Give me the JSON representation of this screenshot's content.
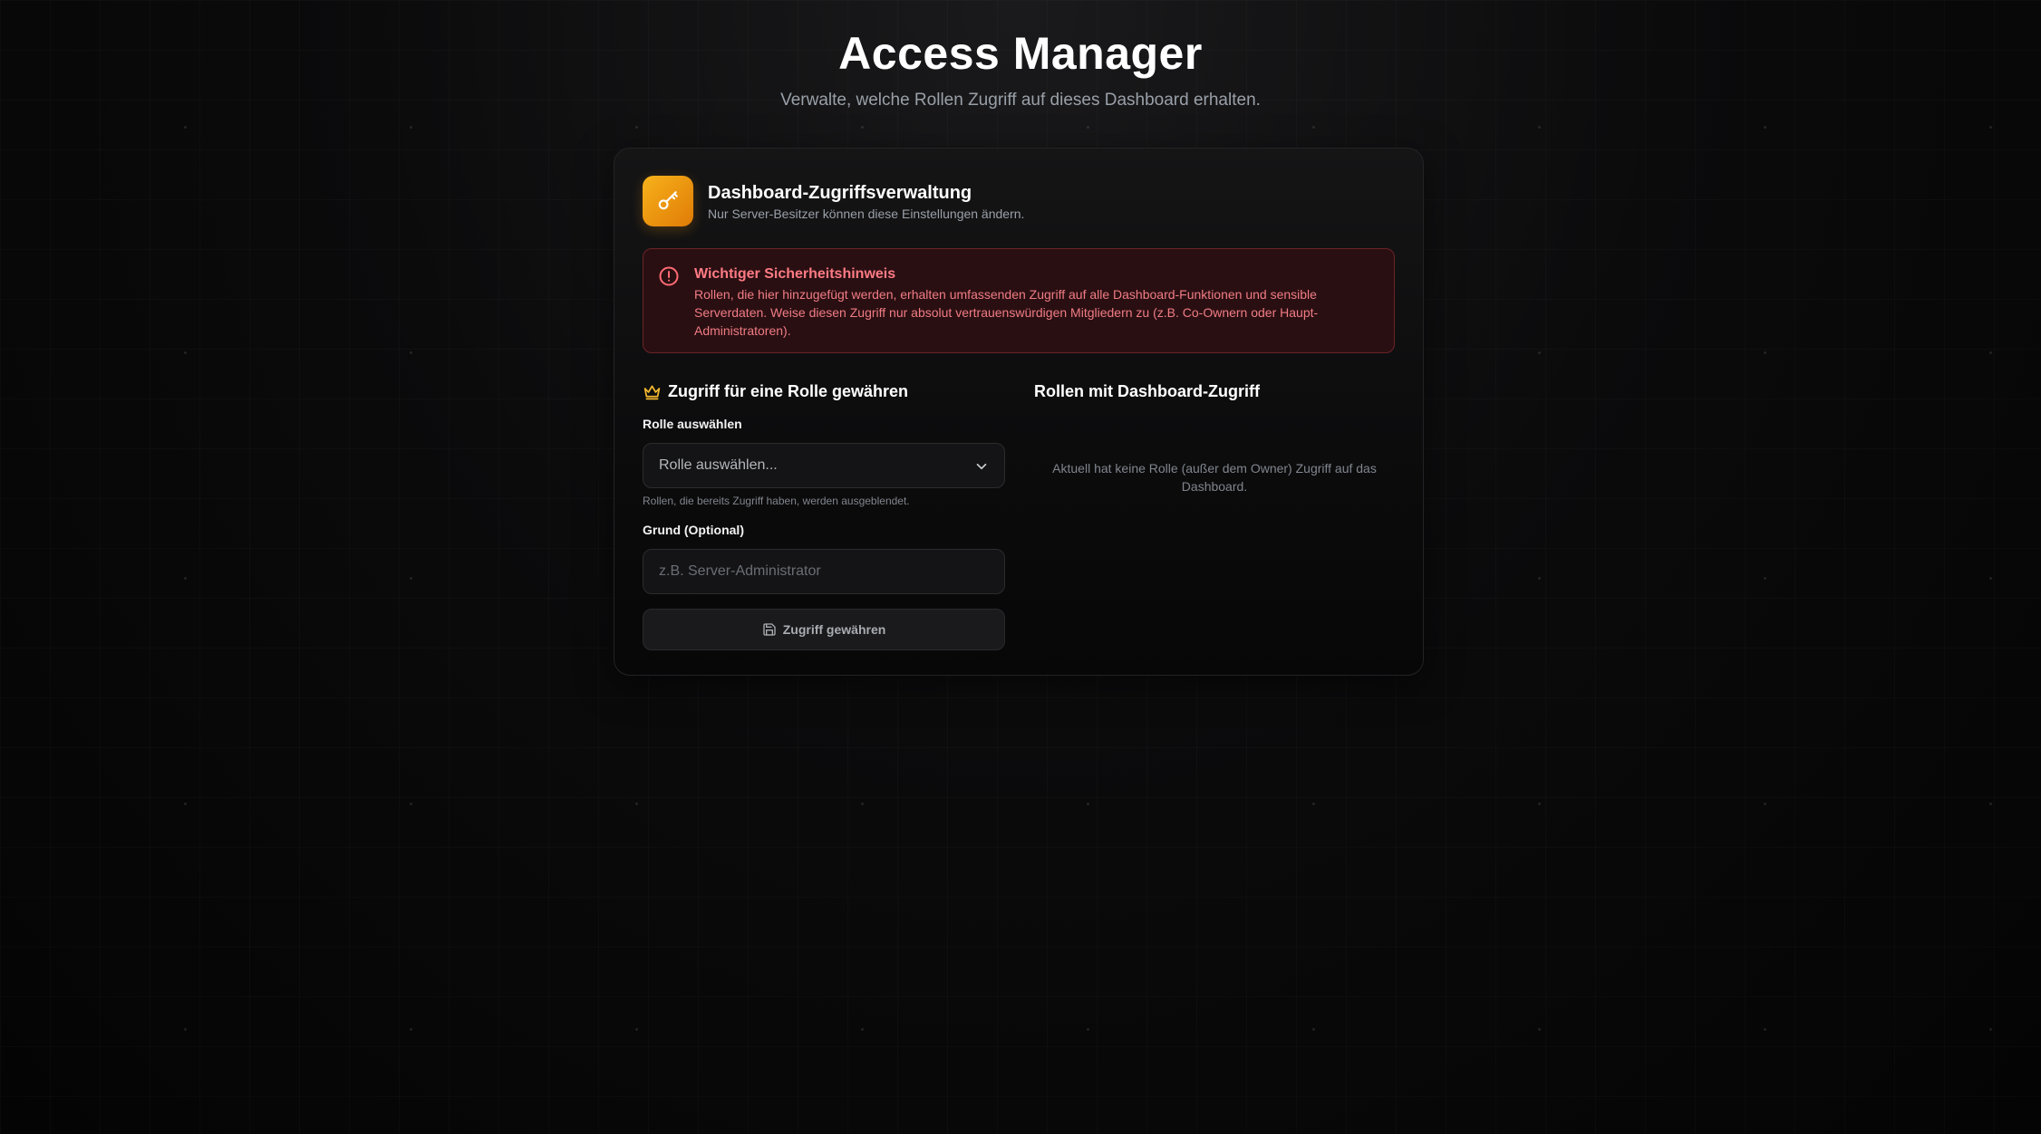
{
  "header": {
    "title": "Access Manager",
    "subtitle": "Verwalte, welche Rollen Zugriff auf dieses Dashboard erhalten."
  },
  "card": {
    "icon": "key-icon",
    "title": "Dashboard-Zugriffsverwaltung",
    "subtitle": "Nur Server-Besitzer können diese Einstellungen ändern."
  },
  "alert": {
    "icon": "alert-circle-icon",
    "title": "Wichtiger Sicherheitshinweis",
    "text": "Rollen, die hier hinzugefügt werden, erhalten umfassenden Zugriff auf alle Dashboard-Funktionen und sensible Serverdaten. Weise diesen Zugriff nur absolut vertrauenswürdigen Mitgliedern zu (z.B. Co-Ownern oder Haupt-Administratoren)."
  },
  "grant": {
    "icon": "crown-icon",
    "title": "Zugriff für eine Rolle gewähren",
    "role_label": "Rolle auswählen",
    "role_select_value": "Rolle auswählen...",
    "role_hint": "Rollen, die bereits Zugriff haben, werden ausgeblendet.",
    "reason_label": "Grund (Optional)",
    "reason_placeholder": "z.B. Server-Administrator",
    "reason_value": "",
    "button_label": "Zugriff gewähren",
    "button_icon": "save-icon"
  },
  "access_list": {
    "title": "Rollen mit Dashboard-Zugriff",
    "empty_text": "Aktuell hat keine Rolle (außer dem Owner) Zugriff auf das Dashboard."
  },
  "colors": {
    "accent": "#f5a623",
    "danger_text": "#ff7b84",
    "danger_bg": "#2a0f12",
    "background": "#050505"
  }
}
